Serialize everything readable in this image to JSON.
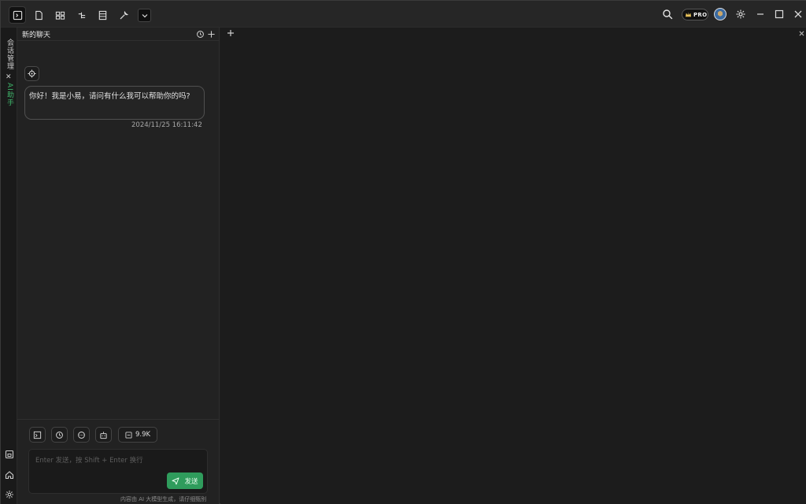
{
  "colors": {
    "accent_green": "#2f9c5c",
    "background": "#1e1e1e",
    "panel": "#222222"
  },
  "titlebar": {
    "tabs": [
      {
        "name": "terminal",
        "icon": "terminal-icon",
        "active": true
      },
      {
        "name": "file",
        "icon": "file-icon"
      },
      {
        "name": "layout",
        "icon": "layout-icon"
      },
      {
        "name": "tree",
        "icon": "tree-icon"
      },
      {
        "name": "list",
        "icon": "list-icon"
      },
      {
        "name": "tools",
        "icon": "wrench-icon"
      }
    ],
    "right_icons": [
      "search-icon",
      "pro-badge",
      "avatar",
      "gear-icon",
      "minimize-icon",
      "maximize-icon",
      "close-icon"
    ],
    "pro_label": "PRO"
  },
  "sidebar": {
    "tab1_label": "会话管理",
    "tab2_label": "AI助手"
  },
  "chat": {
    "title": "新的聊天",
    "message": "你好！我是小易，请问有什么我可以帮助你的吗?",
    "timestamp": "2024/11/25 16:11:42",
    "token_count": "9.9K",
    "input_placeholder": "Enter 发送，按 Shift + Enter 换行",
    "send_label": "发送",
    "disclaimer": "内容由 AI 大模型生成，请仔细甄别"
  }
}
